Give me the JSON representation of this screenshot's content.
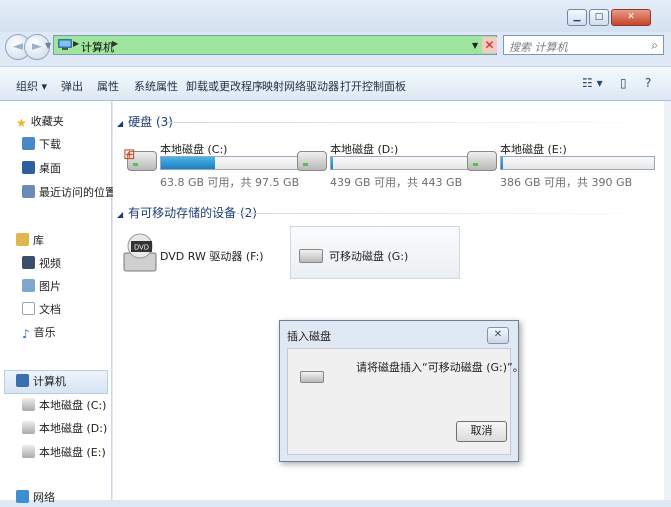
{
  "window": {
    "minimize": "▁",
    "maximize": "□",
    "close": "✕"
  },
  "nav": {
    "back": "◄",
    "forward": "►",
    "address": "计算机",
    "address_sep": "▶",
    "dropdown": "▼",
    "clear": "✕",
    "search_placeholder": "搜索 计算机",
    "search_icon": "search-icon"
  },
  "toolbar": {
    "organize": "组织 ▾",
    "eject": "弹出",
    "properties": "属性",
    "system_properties": "系统属性",
    "uninstall": "卸载或更改程序",
    "map_drive": "映射网络驱动器",
    "control_panel": "打开控制面板",
    "view": "☷ ▾",
    "preview": "▯",
    "help": "?"
  },
  "sidebar": {
    "favorites": "收藏夹",
    "downloads": "下载",
    "desktop": "桌面",
    "recent": "最近访问的位置",
    "libraries": "库",
    "videos": "视频",
    "pictures": "图片",
    "documents": "文档",
    "music": "音乐",
    "computer": "计算机",
    "drive_c": "本地磁盘 (C:)",
    "drive_d": "本地磁盘 (D:)",
    "drive_e": "本地磁盘 (E:)",
    "network": "网络"
  },
  "content": {
    "hdd_group": "硬盘 (3)",
    "removable_group": "有可移动存储的设备 (2)",
    "drives": [
      {
        "name": "本地磁盘 (C:)",
        "free": "63.8 GB 可用，共 97.5 GB",
        "used_fraction": 0.35
      },
      {
        "name": "本地磁盘 (D:)",
        "free": "439 GB 可用，共 443 GB",
        "used_fraction": 0.01
      },
      {
        "name": "本地磁盘 (E:)",
        "free": "386 GB 可用，共 390 GB",
        "used_fraction": 0.01
      }
    ],
    "dvd": "DVD RW 驱动器 (F:)",
    "dvd_badge": "DVD",
    "removable": "可移动磁盘 (G:)"
  },
  "dialog": {
    "title": "插入磁盘",
    "close": "✕",
    "message": "请将磁盘插入“可移动磁盘 (G:)”。",
    "cancel": "取消"
  },
  "colors": {
    "address_bg": "#9ee69d",
    "bar_fill": "#1a7fc1"
  }
}
